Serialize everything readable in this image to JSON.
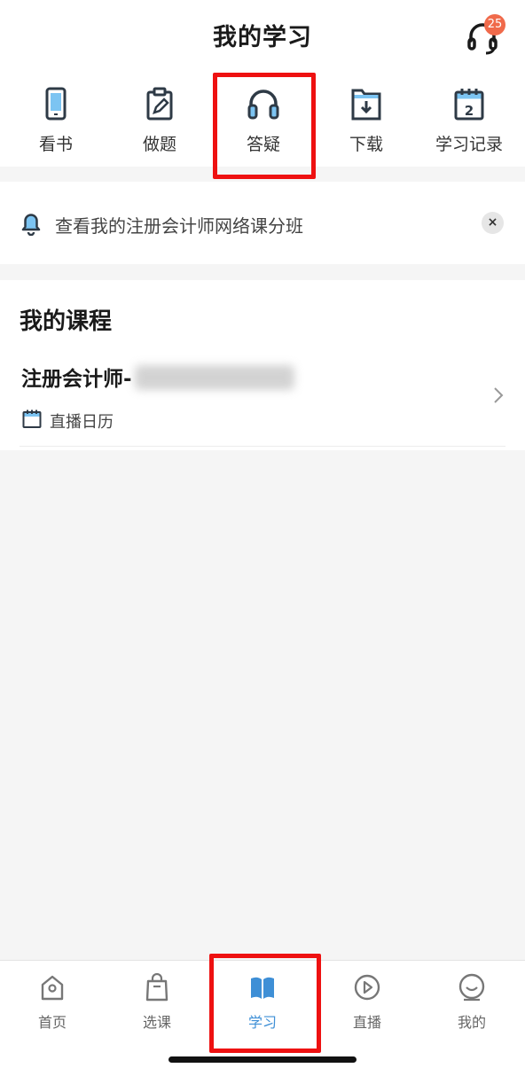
{
  "header": {
    "title": "我的学习",
    "service_icon": "headset-icon",
    "badge_count": "25"
  },
  "quick_menu": {
    "items": [
      {
        "label": "看书",
        "icon": "phone-book-icon"
      },
      {
        "label": "做题",
        "icon": "clipboard-pencil-icon"
      },
      {
        "label": "答疑",
        "icon": "headphones-icon"
      },
      {
        "label": "下载",
        "icon": "download-folder-icon"
      },
      {
        "label": "学习记录",
        "icon": "calendar-record-icon"
      }
    ],
    "highlighted_index": 2
  },
  "notice": {
    "text": "查看我的注册会计师网络课分班",
    "close_label": "×"
  },
  "courses": {
    "section_title": "我的课程",
    "items": [
      {
        "name": "注册会计师-",
        "live_label": "直播日历"
      }
    ]
  },
  "tabbar": {
    "items": [
      {
        "label": "首页",
        "icon": "home-icon"
      },
      {
        "label": "选课",
        "icon": "shopping-bag-icon"
      },
      {
        "label": "学习",
        "icon": "open-book-icon"
      },
      {
        "label": "直播",
        "icon": "play-circle-icon"
      },
      {
        "label": "我的",
        "icon": "smile-face-icon"
      }
    ],
    "active_index": 2
  },
  "colors": {
    "accent": "#3e8fd6",
    "badge": "#f06a4b",
    "highlight": "#ee1111",
    "icon_dark": "#2e3a46",
    "icon_fill": "#7cc4f2"
  }
}
